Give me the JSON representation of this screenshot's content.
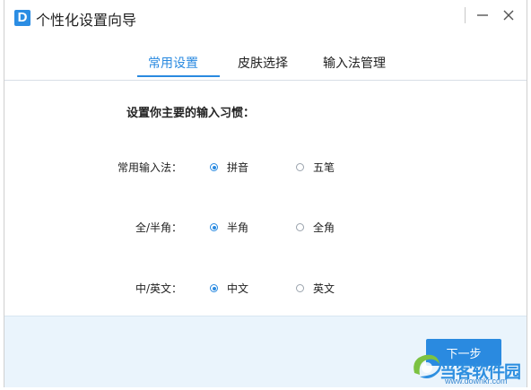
{
  "window": {
    "title": "个性化设置向导",
    "logo_letter": "D"
  },
  "tabs": [
    {
      "label": "常用设置",
      "active": true
    },
    {
      "label": "皮肤选择",
      "active": false
    },
    {
      "label": "输入法管理",
      "active": false
    }
  ],
  "content": {
    "section_title": "设置你主要的输入习惯：",
    "options": [
      {
        "label": "常用输入法：",
        "choices": [
          "拼音",
          "五笔"
        ],
        "selected": "拼音"
      },
      {
        "label": "全/半角：",
        "choices": [
          "半角",
          "全角"
        ],
        "selected": "半角"
      },
      {
        "label": "中/英文：",
        "choices": [
          "中文",
          "英文"
        ],
        "selected": "中文"
      }
    ]
  },
  "footer": {
    "next_label": "下一步"
  },
  "watermark": {
    "brand": "当客软件园",
    "url": "www.downkr.com"
  },
  "colors": {
    "accent": "#2a8ae0",
    "footer_bg": "#eaf4fc"
  }
}
